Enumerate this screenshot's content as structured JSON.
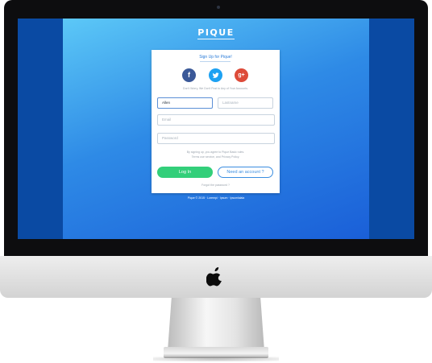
{
  "brand": "PIQUE",
  "form": {
    "signup_link": "Sign Up for Pique!",
    "note": "Don't Worry, We Don't Post to Any of Your Accounts.",
    "fields": {
      "first_name_value": "Allen",
      "last_name_placeholder": "Lastname",
      "email_placeholder": "Email",
      "password_placeholder": "Password"
    },
    "terms_line1": "By signing up, you agree to Pique Basic rules.",
    "terms_line2": "Terms use service, and Privacy Policy.",
    "login_label": "Log In",
    "account_label": "Need an account ?",
    "forgot_label": "Forgot the password ?"
  },
  "footer": "Pique © 2015 · Lorempi · Ipsum · Ipsumlalala",
  "icons": {
    "facebook": "facebook-icon",
    "twitter": "twitter-icon",
    "google_plus": "google-plus-icon",
    "apple_logo": "apple-logo-icon"
  },
  "colors": {
    "primary": "#2a7bd8",
    "login_button": "#33cf7a",
    "facebook": "#3b5998",
    "twitter": "#1da1f2",
    "google_plus": "#dd4b39"
  }
}
